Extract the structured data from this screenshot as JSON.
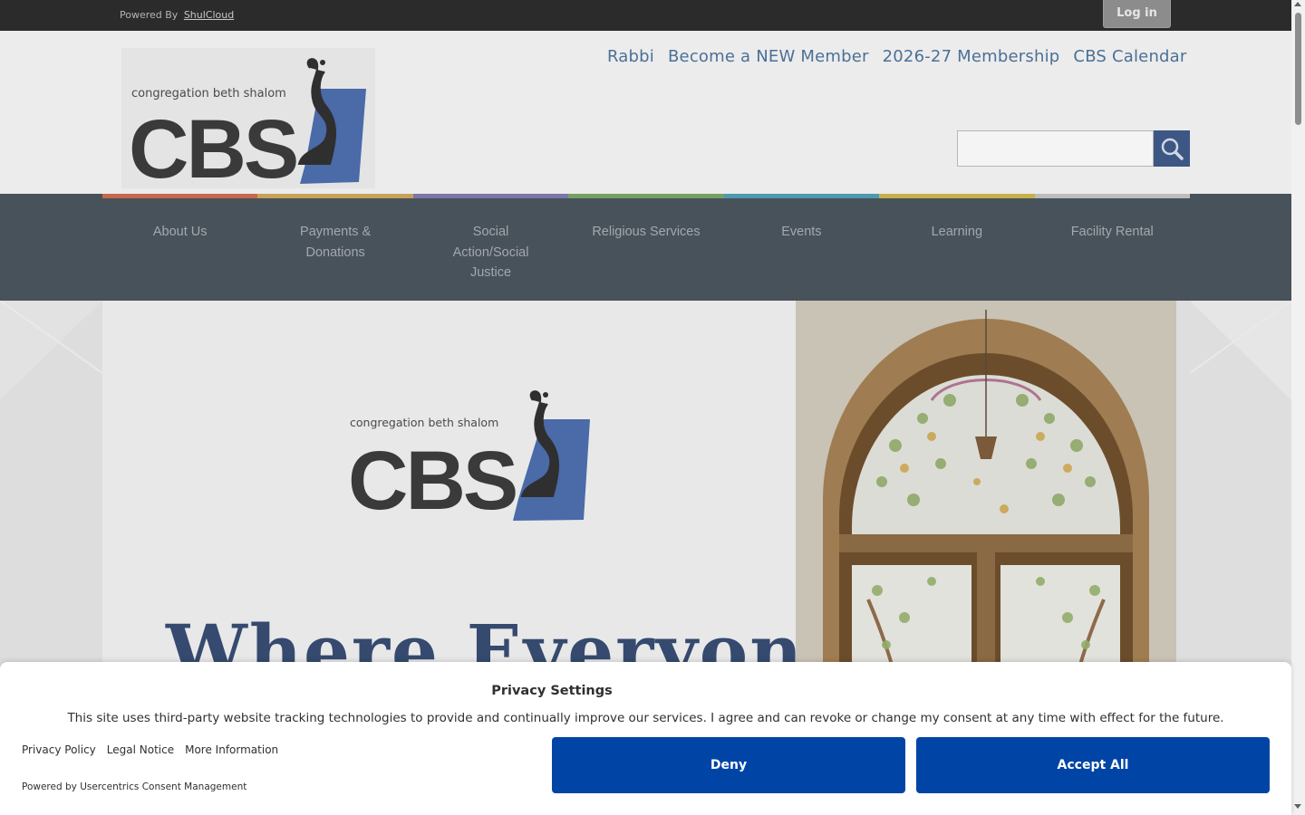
{
  "topbar": {
    "powered_by": "Powered By",
    "powered_link": "ShulCloud",
    "login_label": "Log in"
  },
  "header": {
    "logo_text_small": "congregation beth shalom",
    "logo_text_big": "CBS",
    "top_links": [
      "Rabbi",
      "Become a NEW Member",
      "2026-27 Membership",
      "CBS Calendar"
    ],
    "search_placeholder": ""
  },
  "strip_colors": [
    "#c9674f",
    "#c7a258",
    "#7a76a8",
    "#76a065",
    "#4d9ab0",
    "#c8b14a",
    "#bdbdbd"
  ],
  "nav": {
    "items": [
      "About Us",
      "Payments & Donations",
      "Social Action/Social Justice",
      "Religious Services",
      "Events",
      "Learning",
      "Facility Rental"
    ]
  },
  "hero": {
    "logo_text_small": "congregation beth shalom",
    "logo_text_big": "CBS",
    "slogan": "Where Everyone"
  },
  "consent": {
    "title": "Privacy Settings",
    "text": "This site uses third-party website tracking technologies to provide and continually improve our services. I agree and can revoke or change my consent at any time with effect for the future.",
    "links": [
      "Privacy Policy",
      "Legal Notice",
      "More Information"
    ],
    "powered": "Powered by Usercentrics Consent Management",
    "deny_label": "Deny",
    "accept_label": "Accept All"
  },
  "colors": {
    "brand_blue": "#0045a5",
    "nav_bg": "#48525a",
    "link_blue": "#4b7097",
    "logo_blue": "#4a6aa8"
  }
}
